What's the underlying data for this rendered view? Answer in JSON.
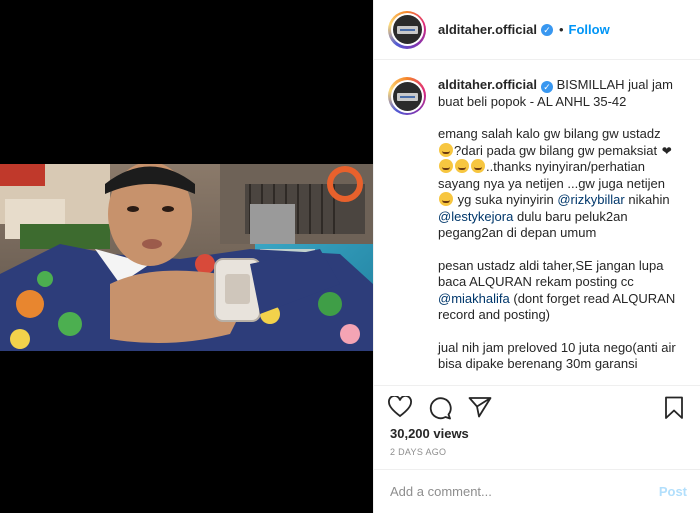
{
  "post": {
    "username": "alditaher.official",
    "follow_label": "Follow",
    "dot": "•",
    "verified_icon": "verified-badge-icon",
    "accent": "#0095f6"
  },
  "caption": {
    "username": "alditaher.official",
    "p1": "BISMILLAH jual jam buat beli popok - AL ANHL 35-42",
    "p2a": "emang salah kalo gw bilang gw ustadz",
    "p2b": "?dari pada gw bilang gw pemaksiat",
    "p2c": "..thanks nyinyiran/perhatian sayang nya ya netijen ...gw juga netijen",
    "p2d": "yg suka nyinyirin",
    "mention1": "@rizkybillar",
    "p2e": "nikahin",
    "mention2": "@lestykejora",
    "p2f": "dulu baru peluk2an pegang2an di depan umum",
    "p3a": "pesan ustadz aldi taher,SE jangan lupa baca ALQURAN rekam posting cc",
    "mention3": "@miakhalifa",
    "p3b": "(dont forget read ALQURAN record and posting)",
    "p4": "jual nih jam preloved 10 juta nego(anti air bisa dipake berenang 30m garansi"
  },
  "actions": {
    "like_icon": "heart-icon",
    "comment_icon": "comment-icon",
    "share_icon": "share-icon",
    "save_icon": "bookmark-icon"
  },
  "stats": {
    "views": "30,200 views",
    "time_ago": "2 DAYS AGO"
  },
  "comment_box": {
    "placeholder": "Add a comment...",
    "post_label": "Post"
  }
}
